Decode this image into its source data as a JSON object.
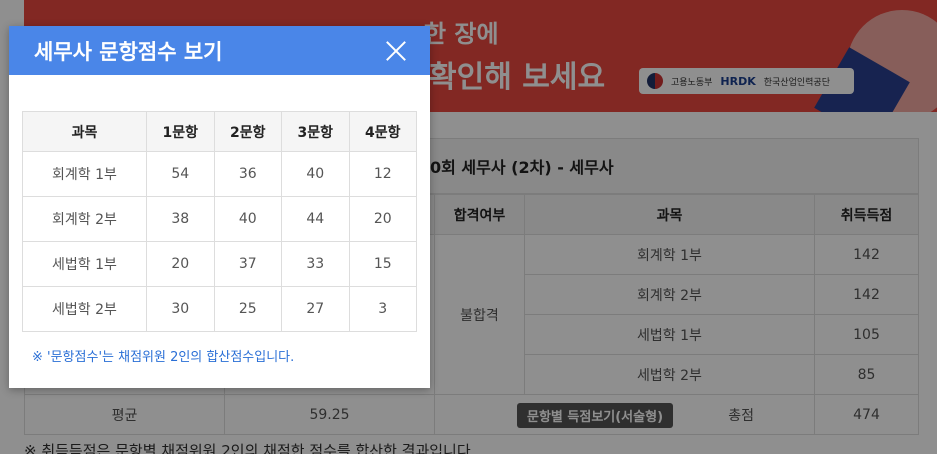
{
  "background": {
    "banner": {
      "line1": "한 장에",
      "line2": "확인해 보세요",
      "logo_text1": "고용노동부",
      "logo_hrdk": "HRDK",
      "logo_text2": "한국산업인력공단"
    },
    "result_title": "0회 세무사 (2차) - 세무사",
    "table": {
      "headers": [
        "합격여부",
        "과목",
        "취득득점"
      ],
      "status": "불합격",
      "rows": [
        {
          "subject": "회계학 1부",
          "score": "142"
        },
        {
          "subject": "회계학 2부",
          "score": "142"
        },
        {
          "subject": "세법학 1부",
          "score": "105"
        },
        {
          "subject": "세법학 2부",
          "score": "85"
        }
      ],
      "avg_label": "평균",
      "avg_value": "59.25",
      "total_label": "총점",
      "total_value": "474"
    },
    "tooltip_button": "문항별 득점보기(서술형)",
    "bottom_note": "※ 취득득점은 문항별 채점위원 2인의 채점한 점수를 합산한 결과입니다."
  },
  "modal": {
    "title": "세무사 문항점수 보기",
    "headers": [
      "과목",
      "1문항",
      "2문항",
      "3문항",
      "4문항"
    ],
    "rows": [
      {
        "subject": "회계학 1부",
        "q1": "54",
        "q2": "36",
        "q3": "40",
        "q4": "12"
      },
      {
        "subject": "회계학 2부",
        "q1": "38",
        "q2": "40",
        "q3": "44",
        "q4": "20"
      },
      {
        "subject": "세법학 1부",
        "q1": "20",
        "q2": "37",
        "q3": "33",
        "q4": "15"
      },
      {
        "subject": "세법학 2부",
        "q1": "30",
        "q2": "25",
        "q3": "27",
        "q4": "3"
      }
    ],
    "note": "※ '문항점수'는 채점위원 2인의 합산점수입니다.",
    "accent_color": "#4a86e8",
    "note_color": "#2a6fd6"
  }
}
